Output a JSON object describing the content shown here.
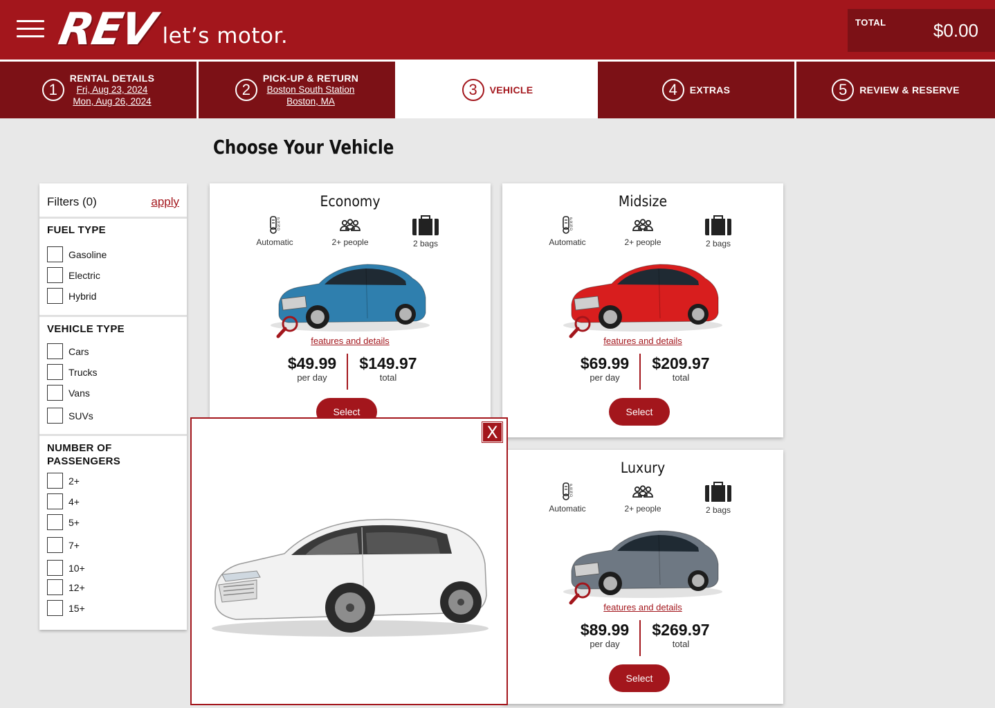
{
  "header": {
    "logo_mark": "REV",
    "logo_tagline": "let’s motor.",
    "total_label": "TOTAL",
    "total_value": "$0.00"
  },
  "steps": [
    {
      "num": "1",
      "title": "RENTAL DETAILS",
      "line1": "Fri, Aug 23, 2024",
      "line2": "Mon, Aug 26, 2024"
    },
    {
      "num": "2",
      "title": "PICK-UP & RETURN",
      "line1": "Boston South Station",
      "line2": "Boston, MA"
    },
    {
      "num": "3",
      "title": "VEHICLE"
    },
    {
      "num": "4",
      "title": "EXTRAS"
    },
    {
      "num": "5",
      "title": "REVIEW & RESERVE"
    }
  ],
  "page_title": "Choose Your Vehicle",
  "filters": {
    "title": "Filters (0)",
    "apply": "apply",
    "groups": [
      {
        "title": "FUEL TYPE",
        "options": [
          "Gasoline",
          "Electric",
          "Hybrid"
        ]
      },
      {
        "title": "VEHICLE TYPE",
        "options": [
          "Cars",
          "Trucks",
          "Vans",
          "SUVs"
        ]
      },
      {
        "title": "NUMBER OF PASSENGERS",
        "options": [
          "2+",
          "4+",
          "5+",
          "7+",
          "10+",
          "12+",
          "15+"
        ]
      }
    ]
  },
  "vehicles": [
    {
      "name": "Economy",
      "transmission": "Automatic",
      "people": "2+ people",
      "bags": "2 bags",
      "link": "features and details",
      "per_day": "$49.99",
      "per_day_label": "per day",
      "total": "$149.97",
      "total_label": "total",
      "select": "Select",
      "color": "#2f7fae"
    },
    {
      "name": "Midsize",
      "transmission": "Automatic",
      "people": "2+ people",
      "bags": "2 bags",
      "link": "features and details",
      "per_day": "$69.99",
      "per_day_label": "per day",
      "total": "$209.97",
      "total_label": "total",
      "select": "Select",
      "color": "#d81e1e"
    },
    {
      "name": "Luxury",
      "transmission": "Automatic",
      "people": "2+ people",
      "bags": "2 bags",
      "link": "features and details",
      "per_day": "$89.99",
      "per_day_label": "per day",
      "total": "$269.97",
      "total_label": "total",
      "select": "Select",
      "color": "#6e7883"
    }
  ],
  "modal": {
    "close": "X"
  },
  "colors": {
    "brand": "#a3161c",
    "brand_dark": "#7c1116",
    "background": "#e8e8e8"
  }
}
